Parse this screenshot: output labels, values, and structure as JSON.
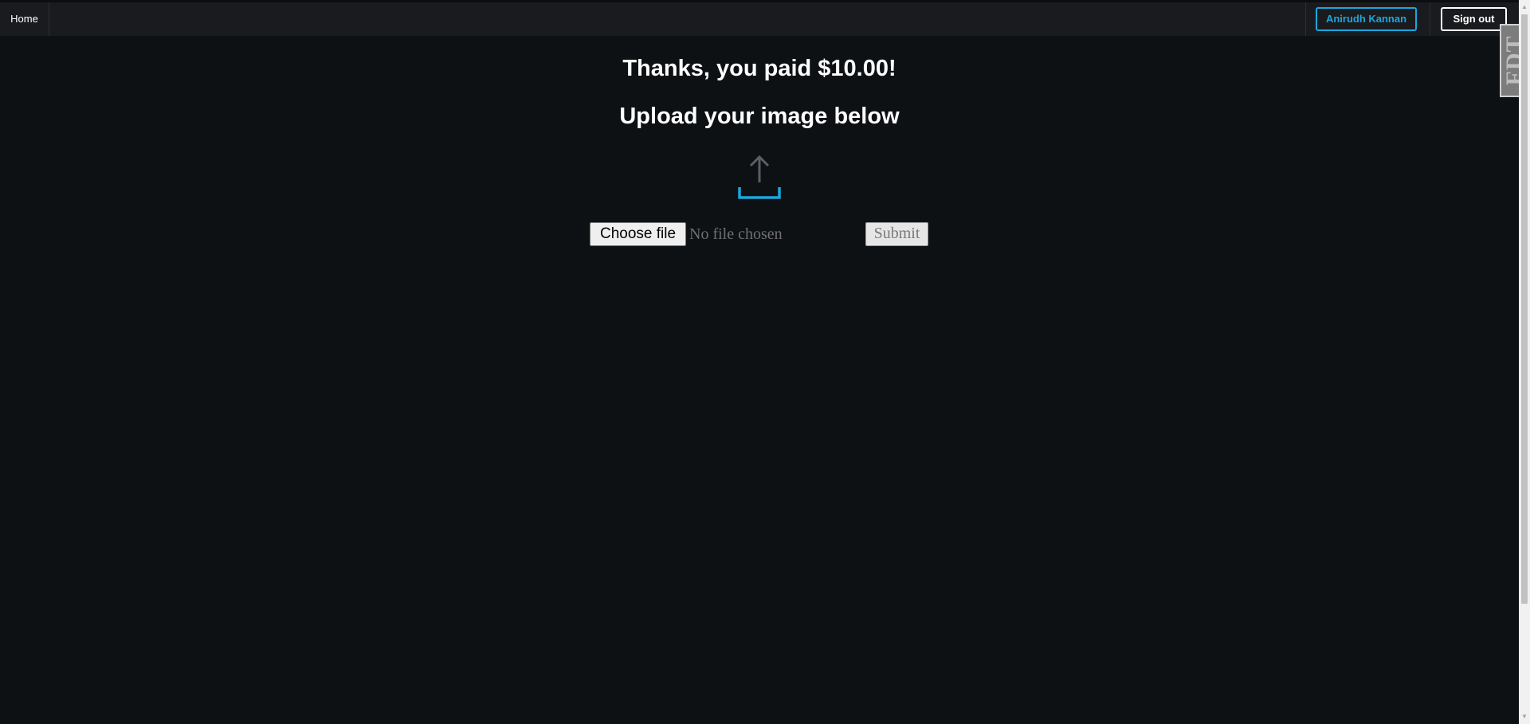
{
  "navbar": {
    "home_label": "Home",
    "user_label": "Anirudh Kannan",
    "signout_label": "Sign out"
  },
  "badge": {
    "label": "FDT"
  },
  "main": {
    "payment_message": "Thanks, you paid $10.00!",
    "upload_prompt": "Upload your image below",
    "upload_icon": "upload-tray-icon",
    "choose_file_label": "Choose file",
    "file_status": "No file chosen",
    "submit_label": "Submit"
  },
  "colors": {
    "background": "#0e1114",
    "navbar": "#1a1b1e",
    "accent": "#1aa7df",
    "text": "#ffffff"
  }
}
